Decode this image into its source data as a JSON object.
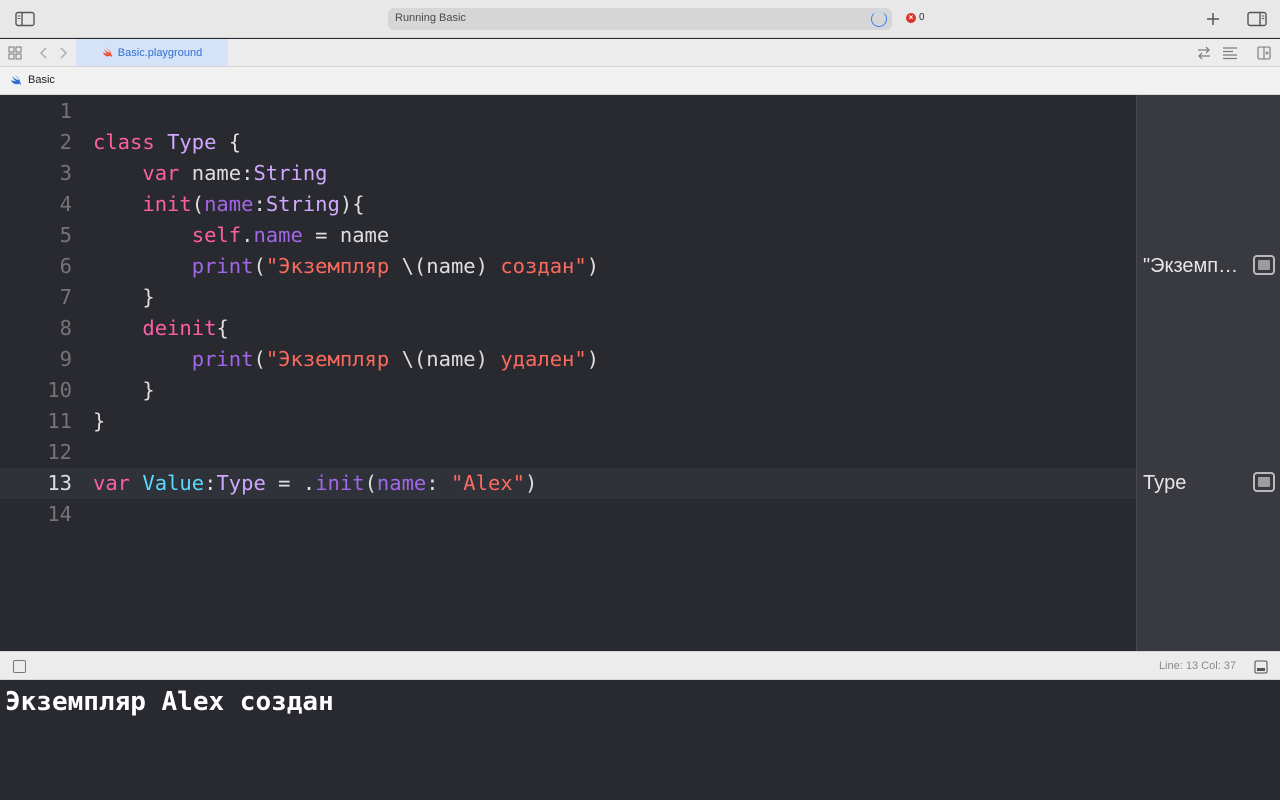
{
  "titlebar": {
    "activity_text": "Running Basic",
    "error_count": "0"
  },
  "tab": {
    "label": "Basic.playground"
  },
  "jumpbar": {
    "crumb": "Basic"
  },
  "editor": {
    "current_line": 13,
    "lines": [
      {
        "n": "1",
        "tokens": []
      },
      {
        "n": "2",
        "tokens": [
          [
            "kw",
            "class"
          ],
          [
            "plain",
            " "
          ],
          [
            "type",
            "Type"
          ],
          [
            "plain",
            " {"
          ]
        ]
      },
      {
        "n": "3",
        "tokens": [
          [
            "plain",
            "    "
          ],
          [
            "kw",
            "var"
          ],
          [
            "plain",
            " name:"
          ],
          [
            "type",
            "String"
          ]
        ]
      },
      {
        "n": "4",
        "tokens": [
          [
            "plain",
            "    "
          ],
          [
            "kw",
            "init"
          ],
          [
            "plain",
            "("
          ],
          [
            "prop",
            "name"
          ],
          [
            "plain",
            ":"
          ],
          [
            "type",
            "String"
          ],
          [
            "plain",
            "){"
          ]
        ]
      },
      {
        "n": "5",
        "tokens": [
          [
            "plain",
            "        "
          ],
          [
            "kw",
            "self"
          ],
          [
            "plain",
            "."
          ],
          [
            "prop",
            "name"
          ],
          [
            "plain",
            " = name"
          ]
        ]
      },
      {
        "n": "6",
        "tokens": [
          [
            "plain",
            "        "
          ],
          [
            "fn",
            "print"
          ],
          [
            "plain",
            "("
          ],
          [
            "str",
            "\"Экземпляр "
          ],
          [
            "plain",
            "\\(name)"
          ],
          [
            "str",
            " создан\""
          ],
          [
            "plain",
            ")"
          ]
        ]
      },
      {
        "n": "7",
        "tokens": [
          [
            "plain",
            "    }"
          ]
        ]
      },
      {
        "n": "8",
        "tokens": [
          [
            "plain",
            "    "
          ],
          [
            "kw",
            "deinit"
          ],
          [
            "plain",
            "{"
          ]
        ]
      },
      {
        "n": "9",
        "tokens": [
          [
            "plain",
            "        "
          ],
          [
            "fn",
            "print"
          ],
          [
            "plain",
            "("
          ],
          [
            "str",
            "\"Экземпляр "
          ],
          [
            "plain",
            "\\(name)"
          ],
          [
            "str",
            " удален\""
          ],
          [
            "plain",
            ")"
          ]
        ]
      },
      {
        "n": "10",
        "tokens": [
          [
            "plain",
            "    }"
          ]
        ]
      },
      {
        "n": "11",
        "tokens": [
          [
            "plain",
            "}"
          ]
        ]
      },
      {
        "n": "12",
        "tokens": []
      },
      {
        "n": "13",
        "tokens": [
          [
            "kw",
            "var"
          ],
          [
            "plain",
            " "
          ],
          [
            "decl",
            "Value"
          ],
          [
            "plain",
            ":"
          ],
          [
            "type",
            "Type"
          ],
          [
            "plain",
            " = ."
          ],
          [
            "fn",
            "init"
          ],
          [
            "plain",
            "("
          ],
          [
            "prop",
            "name"
          ],
          [
            "plain",
            ": "
          ],
          [
            "str",
            "\"Alex\""
          ],
          [
            "plain",
            ")"
          ]
        ]
      },
      {
        "n": "14",
        "tokens": []
      }
    ]
  },
  "results": {
    "line6": "\"Экземпляр Alex создан\\n\"",
    "line13": "Type"
  },
  "debugbar": {
    "cursor_position": "Line: 13  Col: 37"
  },
  "console": {
    "output": "Экземпляр Alex создан"
  },
  "icons": {
    "sidebar_toggle": "sidebar-left-icon",
    "add": "plus-icon",
    "inspector_toggle": "sidebar-right-icon",
    "grid": "grid-icon",
    "back": "chevron-left-icon",
    "forward": "chevron-right-icon",
    "swift": "swift-icon",
    "refresh": "arrows-icon",
    "lines": "lines-icon",
    "add_editor": "add-editor-icon",
    "debug_area": "debug-area-icon",
    "quick_look": "quick-look-icon",
    "error": "error-icon"
  },
  "colors": {
    "editor_bg": "#292a30",
    "keyword": "#fc5fa3",
    "type": "#d0a8ff",
    "string": "#fc6a5d",
    "function": "#a167e6",
    "declaration": "#5dd8ff",
    "accent": "#2f6fd6"
  }
}
